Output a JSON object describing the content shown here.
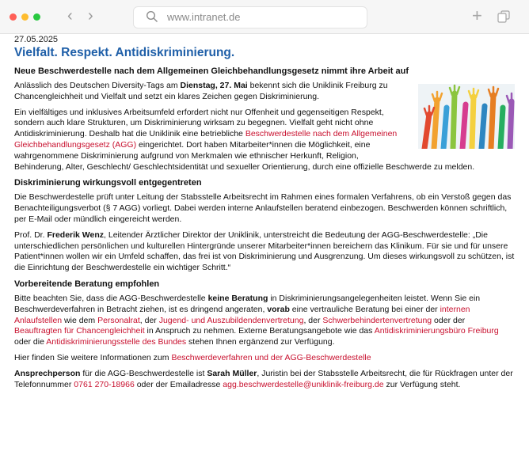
{
  "browser": {
    "url": "www.intranet.de",
    "new_tab_glyph": "+",
    "back_glyph": "‹",
    "forward_glyph": "›",
    "traffic_colors": [
      "#ff5f57",
      "#febc2e",
      "#28c840"
    ]
  },
  "article": {
    "date": "27.05.2025",
    "title": "Vielfalt. Respekt. Antidiskriminierung.",
    "subtitle": "Neue Beschwerdestelle nach dem Allgemeinen Gleichbehandlungsgesetz nimmt ihre Arbeit auf",
    "p1": [
      "Anlässlich des Deutschen Diversity-Tags am ",
      "Dienstag, 27. Mai",
      " bekennt sich die Uniklinik Freiburg zu Chancengleichheit und Vielfalt und setzt ein klares Zeichen gegen Diskriminierung."
    ],
    "p2": [
      "Ein vielfältiges und inklusives Arbeitsumfeld erfordert nicht nur Offenheit und gegenseitigen Respekt, sondern auch klare Strukturen, um Diskriminierung wirksam zu begegnen. Vielfalt geht nicht ohne Antidiskriminierung. Deshalb hat die Uniklinik eine betriebliche ",
      "Beschwerdestelle nach dem Allgemeinen Gleichbehandlungsgesetz (AGG)",
      " eingerichtet. Dort haben Mitarbeiter*innen die Möglichkeit, eine wahrgenommene Diskriminierung aufgrund von Merkmalen wie ethnischer Herkunft, Religion, Behinderung, Alter, Geschlecht/ Geschlechtsidentität und sexueller Orientierung, durch eine offizielle Beschwerde zu melden."
    ],
    "h2": "Diskriminierung wirkungsvoll entgegentreten",
    "p3": "Die Beschwerdestelle prüft unter Leitung der Stabsstelle Arbeitsrecht im Rahmen eines formalen Verfahrens, ob ein Verstoß gegen das Benachteiligungsverbot (§ 7 AGG) vorliegt. Dabei werden interne Anlaufstellen beratend einbezogen. Beschwerden können schriftlich, per E-Mail oder mündlich eingereicht werden.",
    "p4": [
      "Prof. Dr. ",
      "Frederik Wenz",
      ", Leitender Ärztlicher Direktor der Uniklinik, unterstreicht die Bedeutung der AGG-Beschwerdestelle: „Die unterschiedlichen persönlichen und kulturellen Hintergründe unserer Mitarbeiter*innen bereichern das Klinikum. Für sie und für unsere Patient*innen wollen wir ein Umfeld schaffen, das frei ist von Diskriminierung und Ausgrenzung. Um dieses wirkungsvoll zu schützen, ist die Einrichtung der Beschwerdestelle ein wichtiger Schritt.“"
    ],
    "h3": "Vorbereitende Beratung empfohlen",
    "p5": [
      "Bitte beachten Sie, dass die AGG-Beschwerdestelle ",
      "keine Beratung",
      " in Diskriminierungsangelegenheiten leistet. Wenn Sie ein Beschwerdeverfahren in Betracht ziehen, ist es dringend angeraten, ",
      "vorab",
      " eine vertrauliche Beratung bei einer der ",
      "internen Anlaufstellen",
      " wie dem ",
      "Personalrat",
      ", der ",
      "Jugend- und Auszubildendenvertretung",
      ", der ",
      "Schwerbehindertenvertretung",
      " oder der ",
      "Beauftragten für Chancengleichheit",
      " in Anspruch zu nehmen. Externe Beratungsangebote wie das ",
      "Antidiskriminierungsbüro Freiburg",
      " oder die ",
      "Antidiskriminierungsstelle des Bundes",
      " stehen Ihnen ergänzend zur Verfügung."
    ],
    "p6": [
      "Hier finden Sie weitere Informationen zum ",
      "Beschwerdeverfahren und der AGG-Beschwerdestelle"
    ],
    "p7": [
      "Ansprechperson",
      " für die AGG-Beschwerdestelle ist ",
      "Sarah Müller",
      ", Juristin bei der Stabsstelle Arbeitsrecht, die für Rückfragen unter der Telefonnummer ",
      "0761 270-18966",
      " oder der Emailadresse ",
      "agg.beschwerdestelle@uniklinik-freiburg.de",
      " zur Verfügung steht."
    ],
    "image_icon": "raised-colorful-hands-image",
    "link_color": "#c8102e",
    "title_color": "#1f5fa8"
  }
}
